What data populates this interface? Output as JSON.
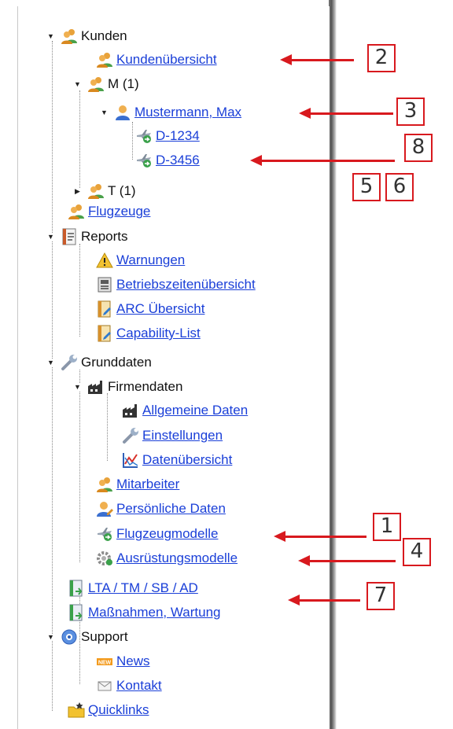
{
  "tree": {
    "kunden": {
      "label": "Kunden",
      "overview": "Kundenübersicht",
      "m_group": "M (1)",
      "customer": "Mustermann, Max",
      "aircraft": [
        "D-1234",
        "D-3456"
      ],
      "t_group": "T (1)"
    },
    "flugzeuge": "Flugzeuge",
    "reports": {
      "label": "Reports",
      "items": [
        "Warnungen",
        "Betriebszeitenübersicht",
        "ARC Übersicht",
        "Capability-List"
      ]
    },
    "grunddaten": {
      "label": "Grunddaten",
      "firmendaten": {
        "label": "Firmendaten",
        "items": [
          "Allgemeine Daten",
          "Einstellungen",
          "Datenübersicht"
        ]
      },
      "items": [
        "Mitarbeiter",
        "Persönliche Daten",
        "Flugzeugmodelle",
        "Ausrüstungsmodelle"
      ]
    },
    "lta": "LTA / TM / SB / AD",
    "massnahmen": "Maßnahmen, Wartung",
    "support": {
      "label": "Support",
      "items": [
        "News",
        "Kontakt"
      ]
    },
    "quicklinks": "Quicklinks"
  },
  "callouts": [
    "2",
    "3",
    "8",
    "5",
    "6",
    "1",
    "4",
    "7"
  ],
  "colors": {
    "link": "#1a3fd8",
    "callout": "#d8191e"
  },
  "icons": {
    "users": "users-icon",
    "user": "user-icon",
    "plane": "airplane-icon",
    "report": "report-icon",
    "warning": "warning-icon",
    "wrench": "wrench-icon",
    "factory": "factory-icon",
    "chart": "chart-icon",
    "gear": "gear-icon",
    "help": "help-icon",
    "news": "new-badge-icon",
    "mail": "mail-icon",
    "folder": "folder-star-icon"
  }
}
